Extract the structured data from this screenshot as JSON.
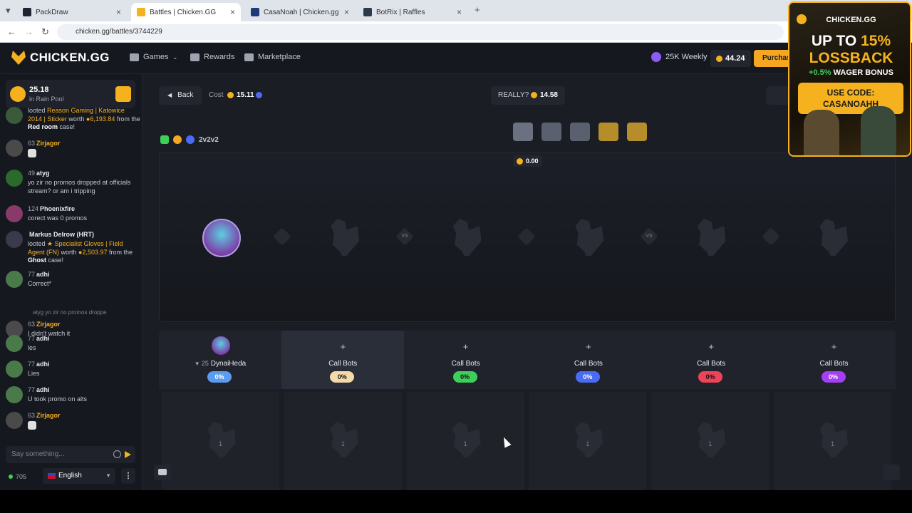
{
  "browser": {
    "tabs": [
      {
        "title": "PackDraw",
        "color": "#1f2430"
      },
      {
        "title": "Battles | Chicken.GG",
        "color": "#f5b21e"
      },
      {
        "title": "CasaNoah | Chicken.gg Leader...",
        "color": "#1f3a7a"
      },
      {
        "title": "BotRix | Raffles",
        "color": "#2d3a4a"
      }
    ],
    "url": "chicken.gg/battles/3744229"
  },
  "header": {
    "logo": "CHICKEN.GG",
    "nav": [
      "Games",
      "Rewards",
      "Marketplace"
    ],
    "weekly": "25K Weekly",
    "balance": "44.24",
    "purchase": "Purchase"
  },
  "chat": {
    "rain_amount": "25.18",
    "rain_label": "in Rain Pool",
    "messages": [
      {
        "level": "",
        "name": "",
        "text_html": "looted <span class='y'>Reason Gaming | Katowice 2014 | Sticker</span> worth <span class='y'>●6,193.84</span> from the <span class='w'>Red room</span> case!"
      },
      {
        "level": "63",
        "name": "Zirjagor",
        "text": "",
        "gold": true
      },
      {
        "level": "49",
        "name": "atyg",
        "text": "yo zir no promos dropped at officials stream? or am i tripping"
      },
      {
        "level": "124",
        "name": "Phoenixfire",
        "text": "corect was 0 promos"
      },
      {
        "level": "",
        "name": "Markus Delrow (HRT)",
        "text_html": "looted <span class='y'>★ Specialist Gloves | Field Agent (FN)</span> worth <span class='y'>●2,503.97</span> from the <span class='w'>Ghost</span> case!"
      },
      {
        "level": "77",
        "name": "adhi",
        "text": "Correct*"
      },
      {
        "level": "63",
        "name": "Zirjagor",
        "text": "I didn't watch it",
        "gold": true,
        "reply": "atyg  yo zir no promos droppe"
      },
      {
        "level": "77",
        "name": "adhi",
        "text": "les"
      },
      {
        "level": "77",
        "name": "adhi",
        "text": "Lies"
      },
      {
        "level": "77",
        "name": "adhi",
        "text": "U took promo on alts"
      },
      {
        "level": "63",
        "name": "Zirjagor",
        "text": "",
        "gold": true
      }
    ],
    "input_placeholder": "Say something...",
    "online": "705",
    "language": "English"
  },
  "battle": {
    "back": "Back",
    "cost_label": "Cost",
    "cost_value": "15.11",
    "really_label": "REALLY?",
    "really_value": "14.58",
    "mode": "2v2v2",
    "pot": "0.00",
    "separators": [
      "",
      "VS",
      "",
      "VS",
      ""
    ],
    "players": [
      {
        "name": "DynaiHeda",
        "level": "25",
        "pct": "0%",
        "color": "#5b9bf0",
        "joined": true
      },
      {
        "name": "Call Bots",
        "pct": "0%",
        "color": "#f6d9a8",
        "joined": false
      },
      {
        "name": "Call Bots",
        "pct": "0%",
        "color": "#3ecf5a",
        "joined": false
      },
      {
        "name": "Call Bots",
        "pct": "0%",
        "color": "#4a6cf5",
        "joined": false
      },
      {
        "name": "Call Bots",
        "pct": "0%",
        "color": "#f0435a",
        "joined": false
      },
      {
        "name": "Call Bots",
        "pct": "0%",
        "color": "#a53ff5",
        "joined": false
      }
    ],
    "round_number": "1"
  },
  "ad": {
    "brand": "CHICKEN.GG",
    "line1_prefix": "UP TO ",
    "line1_highlight": "15%",
    "line2": "LOSSBACK",
    "line3_highlight": "+0.5%",
    "line3_rest": " WAGER BONUS",
    "code_line1": "USE CODE:",
    "code_line2": "CASANOAHH"
  }
}
